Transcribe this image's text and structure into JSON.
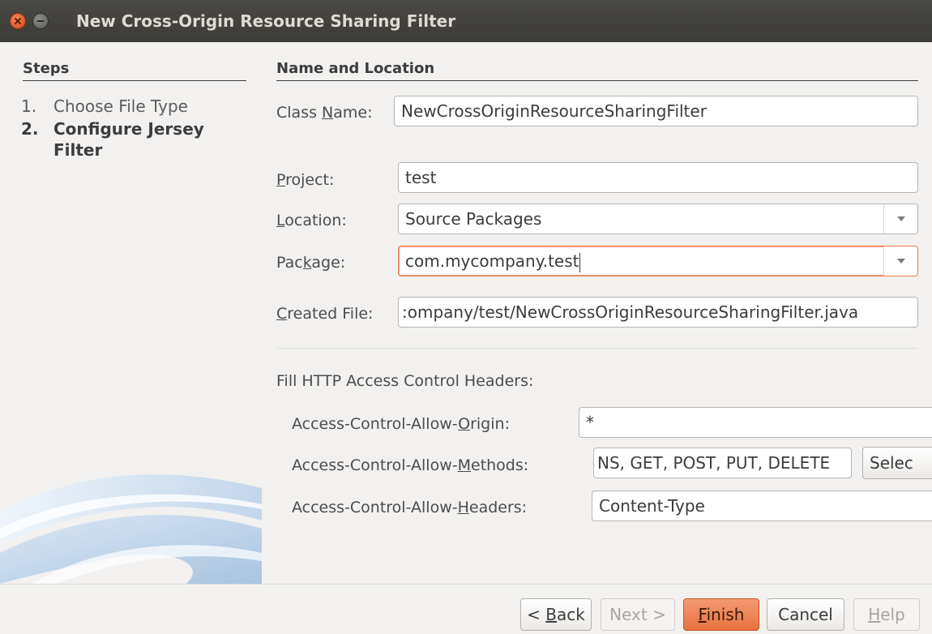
{
  "window": {
    "title": "New Cross-Origin Resource Sharing Filter",
    "close_icon": "close-icon",
    "minimize_icon": "minimize-icon"
  },
  "steps": {
    "heading": "Steps",
    "items": [
      {
        "number": "1.",
        "label": "Choose File Type",
        "current": false
      },
      {
        "number": "2.",
        "label": "Configure Jersey Filter",
        "current": true
      }
    ]
  },
  "main": {
    "heading": "Name and Location",
    "class_name": {
      "label_pre": "Class ",
      "mnemonic": "N",
      "label_post": "ame:",
      "value": "NewCrossOriginResourceSharingFilter"
    },
    "project": {
      "label_pre": "",
      "mnemonic": "P",
      "label_post": "roject:",
      "value": "test"
    },
    "location": {
      "label_pre": "",
      "mnemonic": "L",
      "label_post": "ocation:",
      "value": "Source Packages"
    },
    "package": {
      "label_pre": "Pac",
      "mnemonic": "k",
      "label_post": "age:",
      "value": "com.mycompany.test"
    },
    "created_file": {
      "label_pre": "",
      "mnemonic": "C",
      "label_post": "reated File:",
      "value": ":ompany/test/NewCrossOriginResourceSharingFilter.java"
    },
    "headers_section": "Fill HTTP Access Control Headers:",
    "allow_origin": {
      "label_pre": "Access-Control-Allow-",
      "mnemonic": "O",
      "label_post": "rigin:",
      "value": "*"
    },
    "allow_methods": {
      "label_pre": "Access-Control-Allow-",
      "mnemonic": "M",
      "label_post": "ethods:",
      "value": "NS, GET, POST, PUT, DELETE",
      "select_label": "Selec"
    },
    "allow_headers": {
      "label_pre": "Access-Control-Allow-",
      "mnemonic": "H",
      "label_post": "eaders:",
      "value": "Content-Type"
    }
  },
  "buttons": {
    "back": {
      "pre": "< ",
      "mnemonic": "B",
      "post": "ack",
      "enabled": true
    },
    "next": {
      "label": "Next >",
      "enabled": false
    },
    "finish": {
      "pre": "",
      "mnemonic": "F",
      "post": "inish",
      "enabled": true
    },
    "cancel": {
      "label": "Cancel",
      "enabled": true
    },
    "help": {
      "pre": "",
      "mnemonic": "H",
      "post": "elp",
      "enabled": false
    }
  },
  "colors": {
    "accent": "#e9713f",
    "focus_border": "#e87b4a",
    "titlebar": "#3c3b37"
  }
}
